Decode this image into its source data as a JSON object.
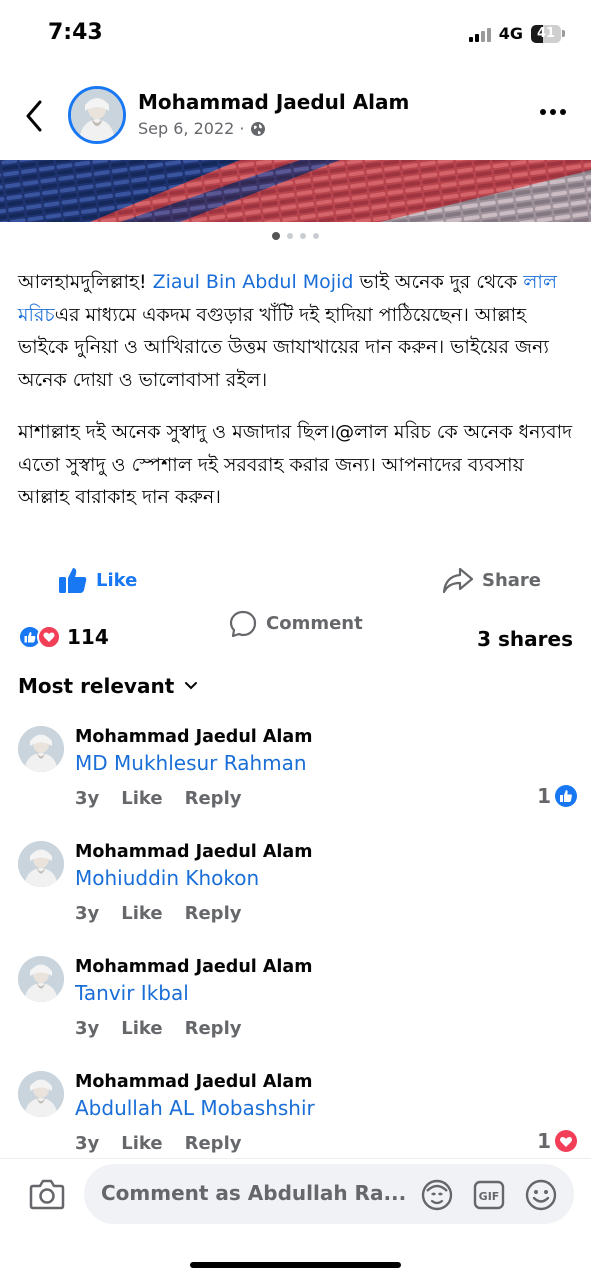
{
  "status_bar": {
    "time": "7:43",
    "network": "4G",
    "battery": "41"
  },
  "post": {
    "author": "Mohammad Jaedul Alam",
    "date": "Sep 6, 2022 ·",
    "paragraph1": {
      "t1": "আলহামদুলিল্লাহ! ",
      "link1": "Ziaul Bin Abdul Mojid",
      "t2": " ভাই অনেক দুর থেকে ",
      "link2": "লাল মরিচ",
      "t3": "এর মাধ্যমে একদম বগুড়ার খাঁটি দই হাদিয়া পাঠিয়েছেন। আল্লাহ ভাইকে দুনিয়া ও আখিরাতে উত্তম জাযাখায়ের দান করুন। ভাইয়ের জন্য অনেক দোয়া ও ভালোবাসা রইল।"
    },
    "paragraph2": "মাশাল্লাহ দই অনেক সুস্বাদু ও মজাদার ছিল।@লাল মরিচ কে অনেক ধন্যবাদ এতো সুস্বাদু ও স্পেশাল দই সরবরাহ করার জন্য। আপনাদের ব্যবসায় আল্লাহ বারাকাহ দান করুন।",
    "photo_dots": 4,
    "active_dot": 0
  },
  "actions": {
    "like": "Like",
    "comment": "Comment",
    "share": "Share"
  },
  "stats": {
    "reactions_count": "114",
    "shares": "3 shares"
  },
  "sort_label": "Most relevant",
  "comments": [
    {
      "name": "Mohammad Jaedul Alam",
      "text": "MD Mukhlesur Rahman",
      "time": "3y",
      "like": "Like",
      "reply": "Reply",
      "reaction_count": "1",
      "reaction": "like"
    },
    {
      "name": "Mohammad Jaedul Alam",
      "text": "Mohiuddin Khokon",
      "time": "3y",
      "like": "Like",
      "reply": "Reply",
      "reaction_count": "",
      "reaction": ""
    },
    {
      "name": "Mohammad Jaedul Alam",
      "text": "Tanvir Ikbal",
      "time": "3y",
      "like": "Like",
      "reply": "Reply",
      "reaction_count": "",
      "reaction": ""
    },
    {
      "name": "Mohammad Jaedul Alam",
      "text": "Abdullah AL Mobashshir",
      "time": "3y",
      "like": "Like",
      "reply": "Reply",
      "reaction_count": "1",
      "reaction": "love"
    }
  ],
  "composer": {
    "placeholder": "Comment as Abdullah Ra..."
  },
  "colors": {
    "accent": "#1877f2",
    "love": "#f33e58",
    "link": "#1a6ed8",
    "muted": "#65676b"
  },
  "icons": [
    "back-arrow-icon",
    "globe-icon",
    "more-icon",
    "like-thumb-icon",
    "comment-bubble-icon",
    "share-arrow-icon",
    "love-heart-icon",
    "chevron-down-icon",
    "camera-icon",
    "avatar-sticker-icon",
    "gif-icon",
    "emoji-icon"
  ]
}
